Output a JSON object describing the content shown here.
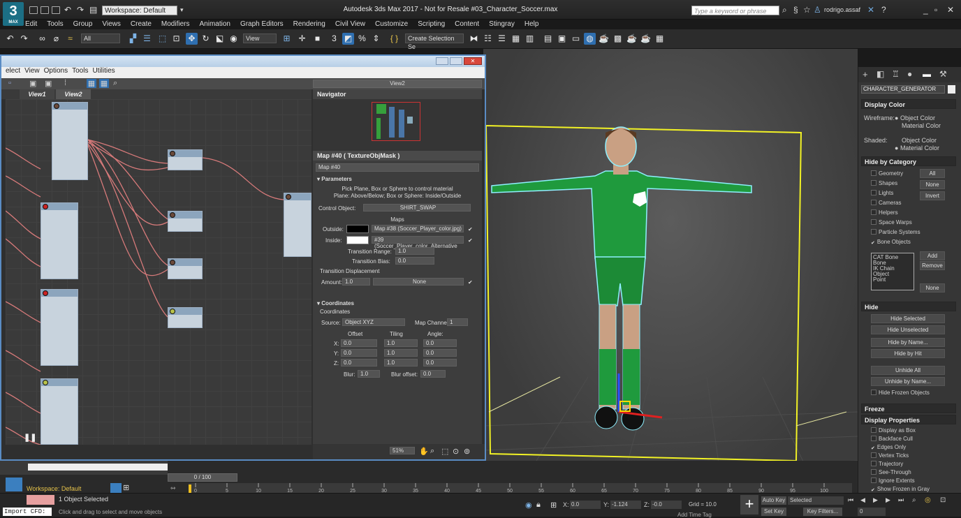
{
  "app": {
    "logo": "3",
    "logo_sub": "MAX",
    "workspace": "Workspace: Default",
    "title": "Autodesk 3ds Max 2017 - Not for Resale   #03_Character_Soccer.max",
    "search_placeholder": "Type a keyword or phrase",
    "user": "rodrigo.assaf"
  },
  "menu": [
    "Edit",
    "Tools",
    "Group",
    "Views",
    "Create",
    "Modifiers",
    "Animation",
    "Graph Editors",
    "Rendering",
    "Civil View",
    "Customize",
    "Scripting",
    "Content",
    "Stingray",
    "Help"
  ],
  "toolbar": {
    "filter": "All",
    "view": "View",
    "selection_set": "Create Selection Se"
  },
  "slate": {
    "menu": [
      "elect",
      "View",
      "Options",
      "Tools",
      "Utilities"
    ],
    "view_dropdown": "View2",
    "tabs": [
      "View1",
      "View2"
    ],
    "zoom": "51%"
  },
  "navigator": {
    "title": "Navigator"
  },
  "params": {
    "header": "Map #40  ( TextureObjMask )",
    "map_name": "Map #40",
    "section": "Parameters",
    "desc1": "Pick Plane, Box or Sphere to control material",
    "desc2": "Plane: Above/Below; Box or Sphere: Inside/Outside",
    "control_label": "Control Object:",
    "control_value": "SHIRT_SWAP",
    "maps_label": "Maps",
    "outside_label": "Outside:",
    "outside_map": "Map #38 (Soccer_Player_color.jpg)",
    "inside_label": "Inside:",
    "inside_map": "#39 (Soccer_Player_color_Alternative",
    "tr_range_label": "Transition Range:",
    "tr_range": "1.0",
    "tr_bias_label": "Transition Bias:",
    "tr_bias": "0.0",
    "tr_disp": "Transition Displacement",
    "amount_label": "Amount:",
    "amount": "1.0",
    "none": "None",
    "coords_header": "Coordinates",
    "coords_sub": "Coordinates",
    "source_label": "Source:",
    "source": "Object XYZ",
    "map_channel": "Map Channel:",
    "map_channel_val": "1",
    "offset": "Offset",
    "tiling": "Tiling",
    "angle": "Angle:",
    "x": "X:",
    "y": "Y:",
    "z": "Z:",
    "off_vals": [
      "0.0",
      "0.0",
      "0.0"
    ],
    "til_vals": [
      "1.0",
      "1.0",
      "1.0"
    ],
    "ang_vals": [
      "0.0",
      "0.0",
      "0.0"
    ],
    "blur_label": "Blur:",
    "blur": "1.0",
    "bluroff_label": "Blur offset:",
    "bluroff": "0.0"
  },
  "cmd": {
    "name": "CHARACTER_GENERATOR",
    "display_color": "Display Color",
    "wireframe": "Wireframe:",
    "object_color": "Object Color",
    "material_color": "Material Color",
    "shaded": "Shaded:",
    "hide_by_cat": "Hide by Category",
    "cats": [
      "Geometry",
      "Shapes",
      "Lights",
      "Cameras",
      "Helpers",
      "Space Warps",
      "Particle Systems",
      "Bone Objects"
    ],
    "all": "All",
    "none": "None",
    "invert": "Invert",
    "list": [
      "CAT Bone",
      "Bone",
      "IK Chain Object",
      "Point"
    ],
    "add": "Add",
    "remove": "Remove",
    "hide": "Hide",
    "hide_btns": [
      "Hide Selected",
      "Hide Unselected",
      "Hide by Name...",
      "Hide by Hit",
      "Unhide All",
      "Unhide by Name..."
    ],
    "hide_frozen": "Hide Frozen Objects",
    "freeze": "Freeze",
    "display_props": "Display Properties",
    "props": [
      "Display as Box",
      "Backface Cull",
      "Edges Only",
      "Vertex Ticks",
      "Trajectory",
      "See-Through",
      "Ignore Extents",
      "Show Frozen in Gray"
    ]
  },
  "timeline": {
    "frame": "0 / 100",
    "ticks": [
      "0",
      "5",
      "10",
      "15",
      "20",
      "25",
      "30",
      "35",
      "40",
      "45",
      "50",
      "55",
      "60",
      "65",
      "70",
      "75",
      "80",
      "85",
      "90",
      "95",
      "100"
    ]
  },
  "status": {
    "workspace": "Workspace: Default",
    "selected": "1 Object Selected",
    "hint": "Click and drag to select and move objects",
    "import": "Import CFD:",
    "x_label": "X:",
    "x": "0.0",
    "y_label": "Y:",
    "y": "-1.124",
    "z_label": "Z:",
    "z": "-0.0",
    "grid": "Grid = 10.0",
    "autokey": "Auto Key",
    "setkey": "Set Key",
    "selected_dd": "Selected",
    "keyfilters": "Key Filters...",
    "addtime": "Add Time Tag",
    "frame": "0"
  }
}
